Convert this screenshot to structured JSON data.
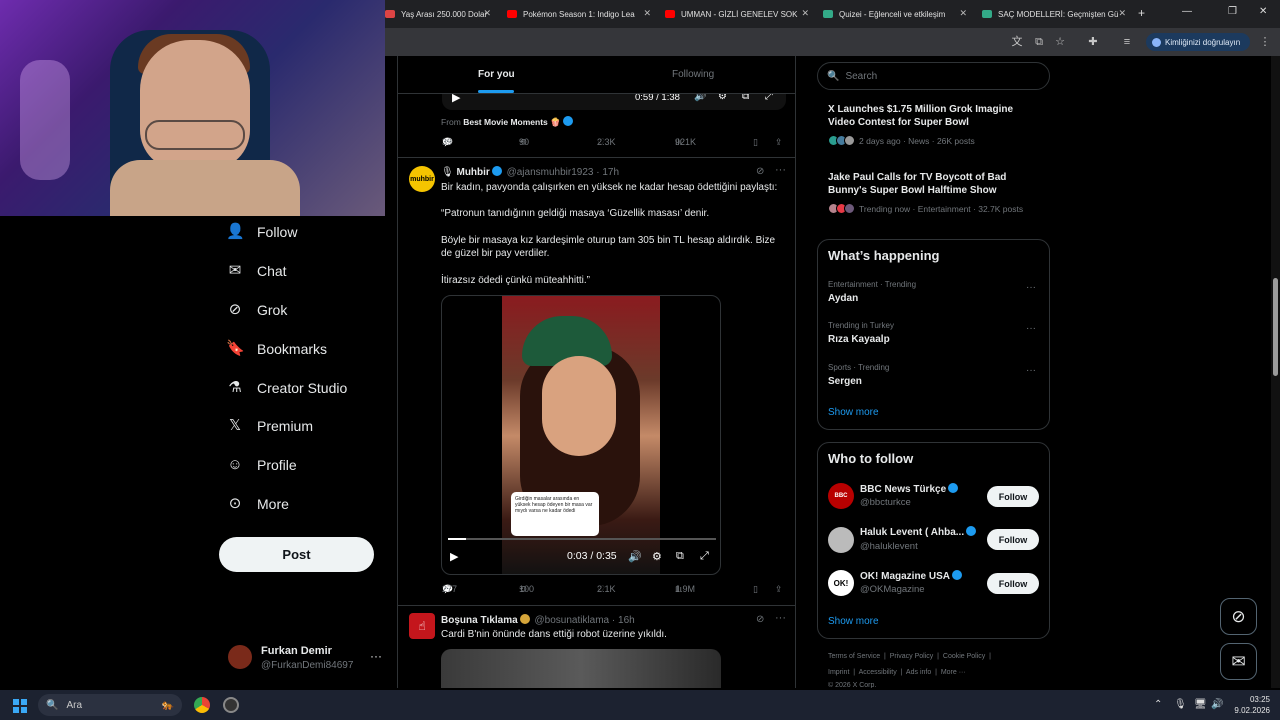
{
  "browser": {
    "tabs": [
      {
        "title": "Yaş Arası 250.000 Dolar",
        "fav_color": "#d44"
      },
      {
        "title": "Pokémon Season 1: Indigo Lea",
        "fav_color": "#f00"
      },
      {
        "title": "UMMAN - GİZLİ GENELEV SOK",
        "fav_color": "#f00"
      },
      {
        "title": "Quizei - Eğlenceli ve etkileşim",
        "fav_color": "#3a8"
      },
      {
        "title": "SAÇ MODELLERİ: Geçmişten Gü",
        "fav_color": "#3a8"
      }
    ],
    "new_tab": "+",
    "verify_label": "Kimliğinizi doğrulayın"
  },
  "nav": {
    "items": [
      {
        "label": "Follow",
        "icon": "person-plus-icon"
      },
      {
        "label": "Chat",
        "icon": "mail-icon"
      },
      {
        "label": "Grok",
        "icon": "grok-icon"
      },
      {
        "label": "Bookmarks",
        "icon": "bookmark-icon"
      },
      {
        "label": "Creator Studio",
        "icon": "flask-icon"
      },
      {
        "label": "Premium",
        "icon": "x-logo-icon"
      },
      {
        "label": "Profile",
        "icon": "person-icon"
      },
      {
        "label": "More",
        "icon": "more-circle-icon"
      }
    ],
    "post_label": "Post",
    "account": {
      "name": "Furkan Demir",
      "handle": "@FurkanDemi84697"
    }
  },
  "feed": {
    "tabs": {
      "for_you": "For you",
      "following": "Following"
    },
    "prev_post": {
      "video_time": "0:59 / 1:38",
      "from_prefix": "From",
      "from_name": "Best Movie Moments 🍿",
      "replies": "39",
      "reposts": "90",
      "likes": "2.3K",
      "views": "921K"
    },
    "post1": {
      "name": "Muhbir",
      "handle": "@ajansmuhbir1923",
      "time": "17h",
      "avatar_text": "muhbir",
      "para1": "Bir kadın, pavyonda çalışırken en yüksek ne kadar hesap ödettiğini paylaştı:",
      "para2": "“Patronun tanıdığının geldiği masaya ‘Güzellik masası’ denir.",
      "para3": "Böyle bir masaya kız kardeşimle oturup tam 305 bin TL hesap aldırdık. Bize de güzel bir pay verdiler.",
      "para4": "İtirazsız ödedi çünkü müteahhitti.”",
      "video_time": "0:03 / 0:35",
      "video_caption": "Girdiğin masalar arasında en yüksek hesap ödeyen bir masa var mıydı varsa ne kadar ödedi",
      "replies": "277",
      "reposts": "100",
      "likes": "2.1K",
      "views": "1.9M"
    },
    "post2": {
      "name": "Boşuna Tıklama",
      "handle": "@bosunatiklama",
      "time": "16h",
      "text": "Cardi B'nin önünde dans ettiği robot üzerine yıkıldı."
    }
  },
  "right": {
    "search_placeholder": "Search",
    "news": [
      {
        "title": "X Launches $1.75 Million Grok Imagine Video Contest for Super Bowl",
        "meta": "2 days ago · News · 26K posts"
      },
      {
        "title": "Jake Paul Calls for TV Boycott of Bad Bunny's Super Bowl Halftime Show",
        "meta": "Trending now · Entertainment · 32.7K posts"
      }
    ],
    "happening": {
      "title": "What’s happening",
      "trends": [
        {
          "category": "Entertainment · Trending",
          "name": "Aydan"
        },
        {
          "category": "Trending in Turkey",
          "name": "Rıza Kayaalp"
        },
        {
          "category": "Sports · Trending",
          "name": "Sergen"
        }
      ],
      "show_more": "Show more"
    },
    "who_to_follow": {
      "title": "Who to follow",
      "accounts": [
        {
          "name": "BBC News Türkçe",
          "handle": "@bbcturkce",
          "avatar_color": "#b80000"
        },
        {
          "name": "Haluk Levent ( Ahba...",
          "handle": "@haluklevent",
          "avatar_color": "#ccc"
        },
        {
          "name": "OK! Magazine USA",
          "handle": "@OKMagazine",
          "avatar_color": "#fff"
        }
      ],
      "follow_label": "Follow",
      "show_more": "Show more"
    },
    "footer": {
      "row1": "Terms of Service  |  Privacy Policy  |  Cookie Policy  |",
      "row2": "Imprint  |  Accessibility  |  Ads info  |  More ···",
      "row3": "© 2026 X Corp."
    }
  },
  "taskbar": {
    "search_label": "Ara",
    "time": "03:25",
    "date": "9.02.2026"
  },
  "colors": {
    "accent": "#1d9bf0",
    "border": "#2f3336",
    "muted": "#71767b"
  }
}
